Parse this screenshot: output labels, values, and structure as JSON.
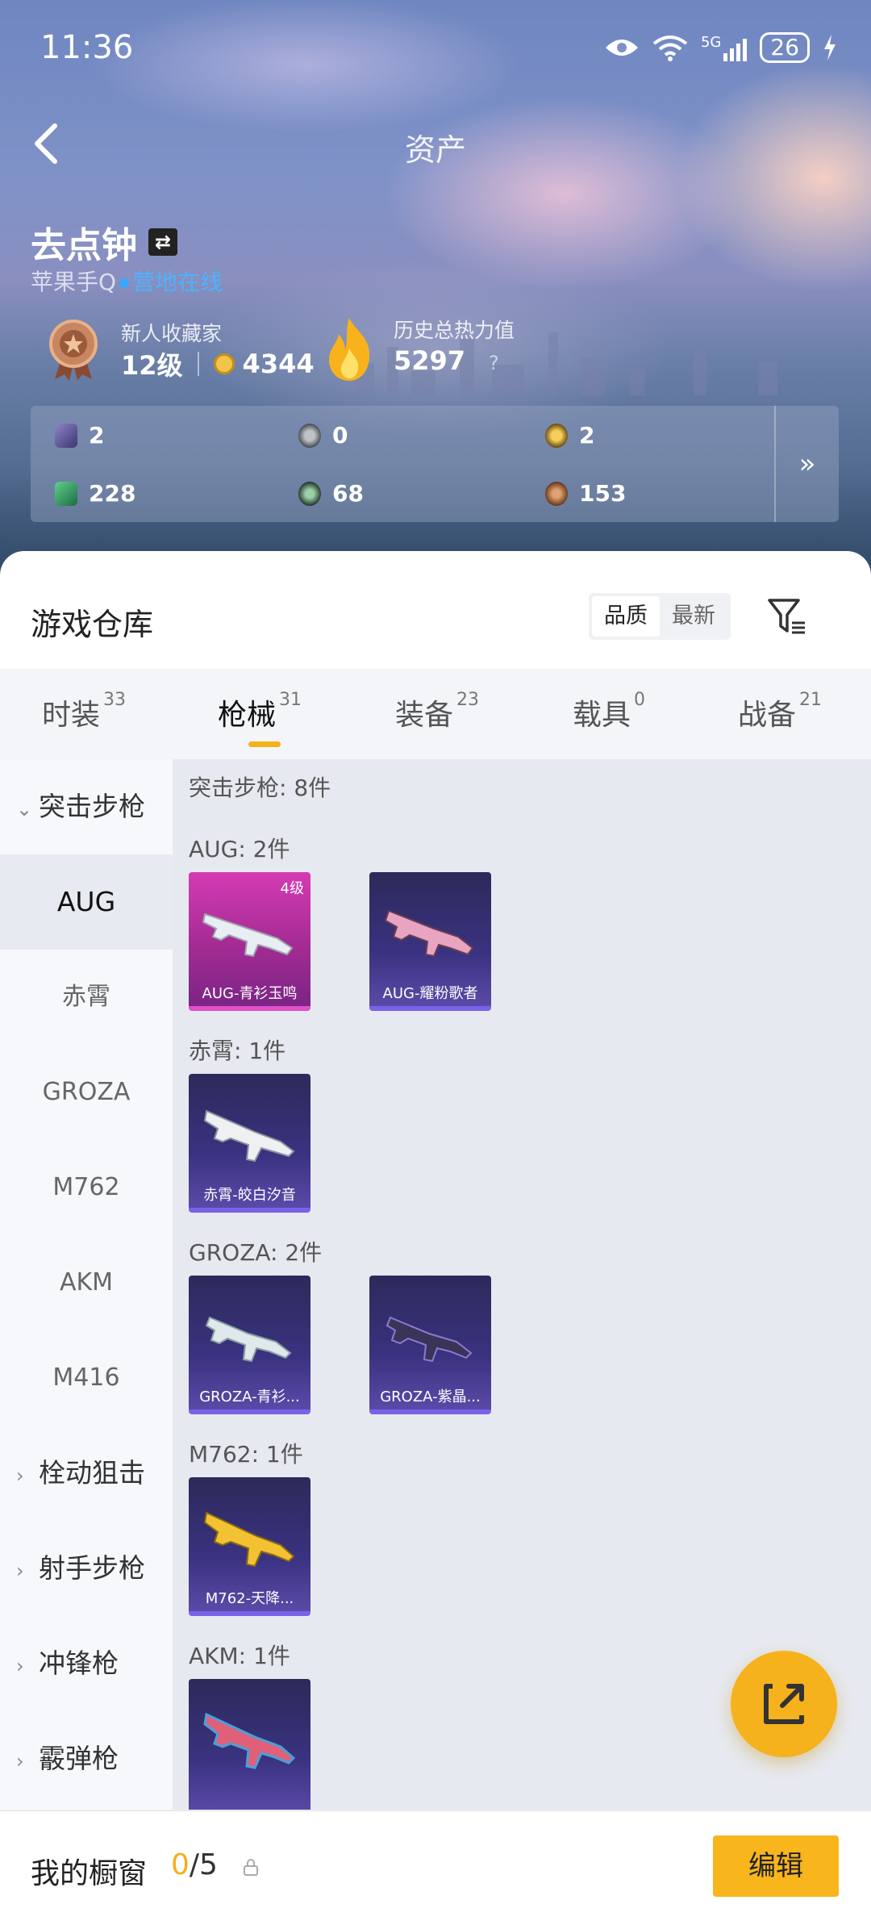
{
  "status_bar": {
    "time": "11:36",
    "signal": "5G",
    "battery": "26"
  },
  "header": {
    "title": "资产"
  },
  "profile": {
    "name": "去点钟",
    "platform": "苹果手Q",
    "online_status": "营地在线",
    "collector_title": "新人收藏家",
    "level": "12级",
    "coins": "4344",
    "heat_label": "历史总热力值",
    "heat_value": "5297",
    "heat_help": "?"
  },
  "stats": [
    "2",
    "0",
    "2",
    "228",
    "68",
    "153"
  ],
  "stats_more": "»",
  "warehouse": {
    "title": "游戏仓库",
    "sort_options": [
      "品质",
      "最新"
    ],
    "sort_selected": "品质"
  },
  "tabs": [
    {
      "label": "时装",
      "count": "33"
    },
    {
      "label": "枪械",
      "count": "31",
      "active": true
    },
    {
      "label": "装备",
      "count": "23"
    },
    {
      "label": "载具",
      "count": "0"
    },
    {
      "label": "战备",
      "count": "21"
    }
  ],
  "sidebar": {
    "category_open": "突击步枪",
    "items": [
      "AUG",
      "赤霄",
      "GROZA",
      "M762",
      "AKM",
      "M416"
    ],
    "selected": "AUG",
    "categories": [
      "栓动狙击",
      "射手步枪",
      "冲锋枪",
      "霰弹枪"
    ]
  },
  "content": {
    "total": "突击步枪: 8件",
    "groups": [
      {
        "title": "AUG: 2件",
        "items": [
          {
            "name": "AUG-青衫玉鸣",
            "level": "4级"
          },
          {
            "name": "AUG-耀粉歌者"
          }
        ]
      },
      {
        "title": "赤霄: 1件",
        "items": [
          {
            "name": "赤霄-皎白汐音"
          }
        ]
      },
      {
        "title": "GROZA: 2件",
        "items": [
          {
            "name": "GROZA-青衫..."
          },
          {
            "name": "GROZA-紫晶..."
          }
        ]
      },
      {
        "title": "M762: 1件",
        "items": [
          {
            "name": "M762-天降..."
          }
        ]
      },
      {
        "title": "AKM: 1件",
        "items": []
      }
    ]
  },
  "showcase": {
    "label": "我的橱窗",
    "count_current": "0",
    "count_max": "/5",
    "edit_label": "编辑"
  }
}
